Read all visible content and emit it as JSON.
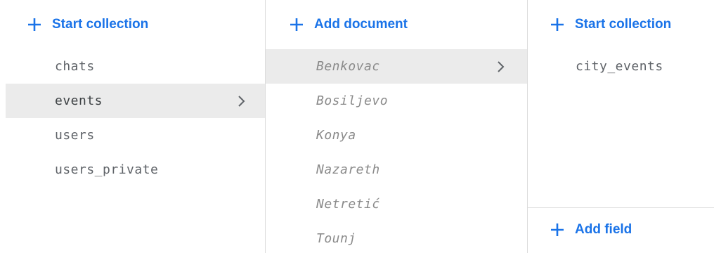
{
  "collections_panel": {
    "action_label": "Start collection",
    "items": [
      {
        "label": "chats"
      },
      {
        "label": "events"
      },
      {
        "label": "users"
      },
      {
        "label": "users_private"
      }
    ],
    "selected": "events"
  },
  "documents_panel": {
    "action_label": "Add document",
    "items": [
      {
        "label": "Benkovac"
      },
      {
        "label": "Bosiljevo"
      },
      {
        "label": "Konya"
      },
      {
        "label": "Nazareth"
      },
      {
        "label": "Netretić"
      },
      {
        "label": "Tounj"
      }
    ],
    "selected": "Benkovac"
  },
  "document_detail_panel": {
    "action_label": "Start collection",
    "items": [
      {
        "label": "city_events"
      }
    ],
    "field_action_label": "Add field"
  },
  "colors": {
    "accent": "#1a73e8",
    "selected_background": "#ebebeb",
    "text": "#5f6368",
    "document_text": "#8a8a8a"
  },
  "icons": {
    "action": "plus-icon",
    "selected_indicator": "chevron-right-icon"
  }
}
